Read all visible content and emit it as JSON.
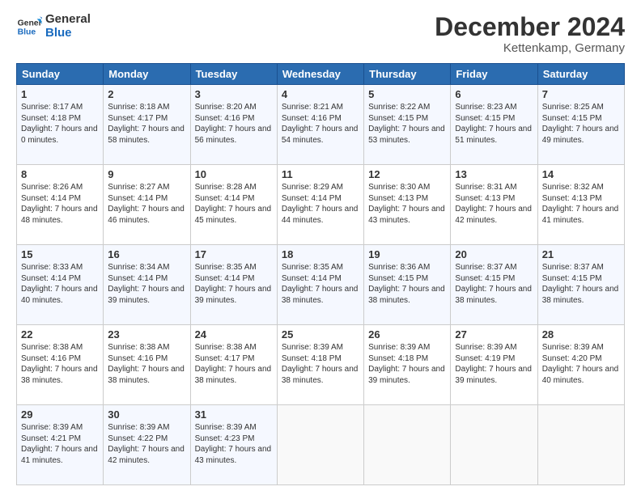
{
  "header": {
    "logo_line1": "General",
    "logo_line2": "Blue",
    "title": "December 2024",
    "subtitle": "Kettenkamp, Germany"
  },
  "days_of_week": [
    "Sunday",
    "Monday",
    "Tuesday",
    "Wednesday",
    "Thursday",
    "Friday",
    "Saturday"
  ],
  "weeks": [
    [
      {
        "day": 1,
        "sunrise": "8:17 AM",
        "sunset": "4:18 PM",
        "daylight": "7 hours and 0 minutes"
      },
      {
        "day": 2,
        "sunrise": "8:18 AM",
        "sunset": "4:17 PM",
        "daylight": "7 hours and 58 minutes"
      },
      {
        "day": 3,
        "sunrise": "8:20 AM",
        "sunset": "4:16 PM",
        "daylight": "7 hours and 56 minutes"
      },
      {
        "day": 4,
        "sunrise": "8:21 AM",
        "sunset": "4:16 PM",
        "daylight": "7 hours and 54 minutes"
      },
      {
        "day": 5,
        "sunrise": "8:22 AM",
        "sunset": "4:15 PM",
        "daylight": "7 hours and 53 minutes"
      },
      {
        "day": 6,
        "sunrise": "8:23 AM",
        "sunset": "4:15 PM",
        "daylight": "7 hours and 51 minutes"
      },
      {
        "day": 7,
        "sunrise": "8:25 AM",
        "sunset": "4:15 PM",
        "daylight": "7 hours and 49 minutes"
      }
    ],
    [
      {
        "day": 8,
        "sunrise": "8:26 AM",
        "sunset": "4:14 PM",
        "daylight": "7 hours and 48 minutes"
      },
      {
        "day": 9,
        "sunrise": "8:27 AM",
        "sunset": "4:14 PM",
        "daylight": "7 hours and 46 minutes"
      },
      {
        "day": 10,
        "sunrise": "8:28 AM",
        "sunset": "4:14 PM",
        "daylight": "7 hours and 45 minutes"
      },
      {
        "day": 11,
        "sunrise": "8:29 AM",
        "sunset": "4:14 PM",
        "daylight": "7 hours and 44 minutes"
      },
      {
        "day": 12,
        "sunrise": "8:30 AM",
        "sunset": "4:13 PM",
        "daylight": "7 hours and 43 minutes"
      },
      {
        "day": 13,
        "sunrise": "8:31 AM",
        "sunset": "4:13 PM",
        "daylight": "7 hours and 42 minutes"
      },
      {
        "day": 14,
        "sunrise": "8:32 AM",
        "sunset": "4:13 PM",
        "daylight": "7 hours and 41 minutes"
      }
    ],
    [
      {
        "day": 15,
        "sunrise": "8:33 AM",
        "sunset": "4:14 PM",
        "daylight": "7 hours and 40 minutes"
      },
      {
        "day": 16,
        "sunrise": "8:34 AM",
        "sunset": "4:14 PM",
        "daylight": "7 hours and 39 minutes"
      },
      {
        "day": 17,
        "sunrise": "8:35 AM",
        "sunset": "4:14 PM",
        "daylight": "7 hours and 39 minutes"
      },
      {
        "day": 18,
        "sunrise": "8:35 AM",
        "sunset": "4:14 PM",
        "daylight": "7 hours and 38 minutes"
      },
      {
        "day": 19,
        "sunrise": "8:36 AM",
        "sunset": "4:15 PM",
        "daylight": "7 hours and 38 minutes"
      },
      {
        "day": 20,
        "sunrise": "8:37 AM",
        "sunset": "4:15 PM",
        "daylight": "7 hours and 38 minutes"
      },
      {
        "day": 21,
        "sunrise": "8:37 AM",
        "sunset": "4:15 PM",
        "daylight": "7 hours and 38 minutes"
      }
    ],
    [
      {
        "day": 22,
        "sunrise": "8:38 AM",
        "sunset": "4:16 PM",
        "daylight": "7 hours and 38 minutes"
      },
      {
        "day": 23,
        "sunrise": "8:38 AM",
        "sunset": "4:16 PM",
        "daylight": "7 hours and 38 minutes"
      },
      {
        "day": 24,
        "sunrise": "8:38 AM",
        "sunset": "4:17 PM",
        "daylight": "7 hours and 38 minutes"
      },
      {
        "day": 25,
        "sunrise": "8:39 AM",
        "sunset": "4:18 PM",
        "daylight": "7 hours and 38 minutes"
      },
      {
        "day": 26,
        "sunrise": "8:39 AM",
        "sunset": "4:18 PM",
        "daylight": "7 hours and 39 minutes"
      },
      {
        "day": 27,
        "sunrise": "8:39 AM",
        "sunset": "4:19 PM",
        "daylight": "7 hours and 39 minutes"
      },
      {
        "day": 28,
        "sunrise": "8:39 AM",
        "sunset": "4:20 PM",
        "daylight": "7 hours and 40 minutes"
      }
    ],
    [
      {
        "day": 29,
        "sunrise": "8:39 AM",
        "sunset": "4:21 PM",
        "daylight": "7 hours and 41 minutes"
      },
      {
        "day": 30,
        "sunrise": "8:39 AM",
        "sunset": "4:22 PM",
        "daylight": "7 hours and 42 minutes"
      },
      {
        "day": 31,
        "sunrise": "8:39 AM",
        "sunset": "4:23 PM",
        "daylight": "7 hours and 43 minutes"
      },
      null,
      null,
      null,
      null
    ]
  ]
}
